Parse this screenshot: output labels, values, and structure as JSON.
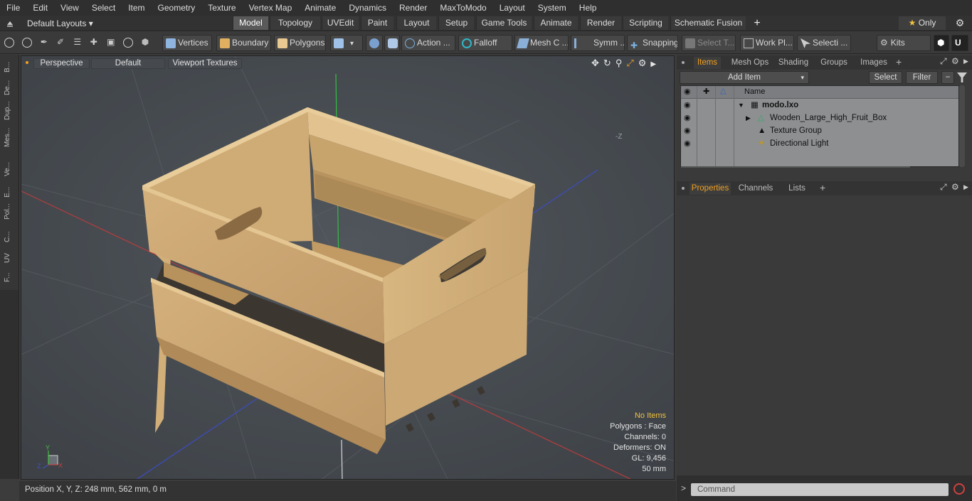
{
  "menu": [
    "File",
    "Edit",
    "View",
    "Select",
    "Item",
    "Geometry",
    "Texture",
    "Vertex Map",
    "Animate",
    "Dynamics",
    "Render",
    "MaxToModo",
    "Layout",
    "System",
    "Help"
  ],
  "layout": {
    "selector": "Default Layouts",
    "tabs": [
      "Model",
      "Topology",
      "UVEdit",
      "Paint",
      "Layout",
      "Setup",
      "Game Tools",
      "Animate",
      "Render",
      "Scripting",
      "Schematic Fusion"
    ],
    "add": "+",
    "only_label": "Only"
  },
  "toolbar": {
    "vertices": "Vertices",
    "boundary": "Boundary",
    "polygons": "Polygons",
    "action": "Action",
    "action_more": "...",
    "falloff": "Falloff",
    "mesh": "Mesh C ...",
    "symm": "Symm ...",
    "snapping": "Snapping",
    "select_t": "Select T...",
    "work_pl": "Work Pl...",
    "selecti": "Selecti ...",
    "kits": "Kits"
  },
  "left_tabs": [
    "B...",
    "De...",
    "Dup...",
    "Mes...",
    "Ve...",
    "E...",
    "Pol...",
    "C...",
    "UV",
    "F..."
  ],
  "viewport": {
    "perspective": "Perspective",
    "default": "Default",
    "textures": "Viewport Textures",
    "axis_neg_z": "-Z",
    "info": {
      "items": "No Items",
      "polygons": "Polygons : Face",
      "channels": "Channels: 0",
      "deformers": "Deformers: ON",
      "gl": "GL: 9,456",
      "scale": "50 mm"
    },
    "axis_y": "Y",
    "axis_x": "X",
    "axis_z": "Z"
  },
  "status": "Position X, Y, Z:   248 mm, 562 mm, 0 m",
  "right": {
    "tabs": [
      "Items",
      "Mesh Ops",
      "Shading",
      "Groups",
      "Images"
    ],
    "add_item": "Add Item",
    "select": "Select",
    "filter": "Filter",
    "name_header": "Name",
    "tree": [
      {
        "label": "modo.lxo"
      },
      {
        "label": "Wooden_Large_High_Fruit_Box"
      },
      {
        "label": "Texture Group"
      },
      {
        "label": "Directional Light"
      }
    ],
    "prop_tabs": [
      "Properties",
      "Channels",
      "Lists"
    ],
    "command_placeholder": "Command",
    "prompt": ">"
  },
  "colors": {
    "accent": "#f0a020",
    "crate": "#c9a674",
    "viewport_bg": "#4a4f55"
  }
}
